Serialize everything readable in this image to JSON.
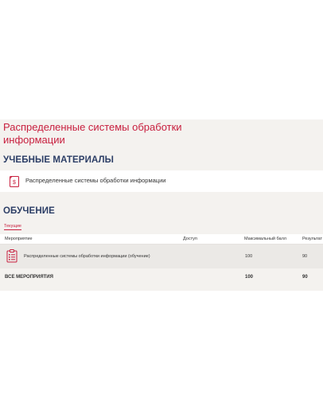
{
  "title": "Распределенные системы обработки информации",
  "materials": {
    "heading": "УЧЕБНЫЕ МАТЕРИАЛЫ",
    "items": [
      {
        "label": "Распределенные системы обработки информации",
        "icon": "document-money-icon"
      }
    ]
  },
  "learning": {
    "heading": "ОБУЧЕНИЕ",
    "tab_current": "Текущие",
    "columns": {
      "event": "Мероприятие",
      "access": "Доступ",
      "max_score": "Максимальный балл",
      "result": "Результат"
    },
    "rows": [
      {
        "icon": "clipboard-list-icon",
        "name": "Распределенные системы обработки информации (обучение)",
        "access": "",
        "max_score": "100",
        "result": "90"
      }
    ],
    "total": {
      "label": "ВСЕ МЕРОПРИЯТИЯ",
      "max_score": "100",
      "result": "90"
    }
  },
  "colors": {
    "accent": "#c8203f",
    "heading": "#2c3e66",
    "panel_bg": "#f4f2ef",
    "row_bg": "#ebe9e6"
  }
}
